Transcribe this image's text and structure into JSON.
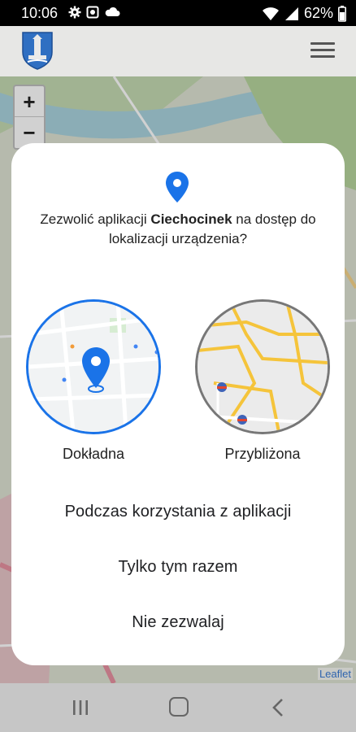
{
  "status_bar": {
    "time": "10:06",
    "battery": "62%",
    "icons": [
      "gear-icon",
      "photo-icon",
      "cloud-icon",
      "wifi-icon",
      "signal-icon",
      "battery-icon"
    ]
  },
  "app_bar": {
    "icons": [
      "city-crest-icon",
      "hamburger-menu-icon"
    ]
  },
  "map": {
    "zoom_in_label": "+",
    "zoom_out_label": "−",
    "attribution": "Leaflet"
  },
  "dialog": {
    "prompt_before": "Zezwolić aplikacji ",
    "app_name": "Ciechocinek",
    "prompt_after": " na dostęp do lokalizacji urządzenia?",
    "options": {
      "precise_label": "Dokładna",
      "approximate_label": "Przybliżona"
    },
    "actions": {
      "while_using": "Podczas korzystania z aplikacji",
      "only_this_time": "Tylko tym razem",
      "deny": "Nie zezwalaj"
    },
    "accent_color": "#1a73e8"
  },
  "nav_bar": {
    "icons": [
      "recent-apps-icon",
      "home-icon",
      "back-icon"
    ]
  }
}
